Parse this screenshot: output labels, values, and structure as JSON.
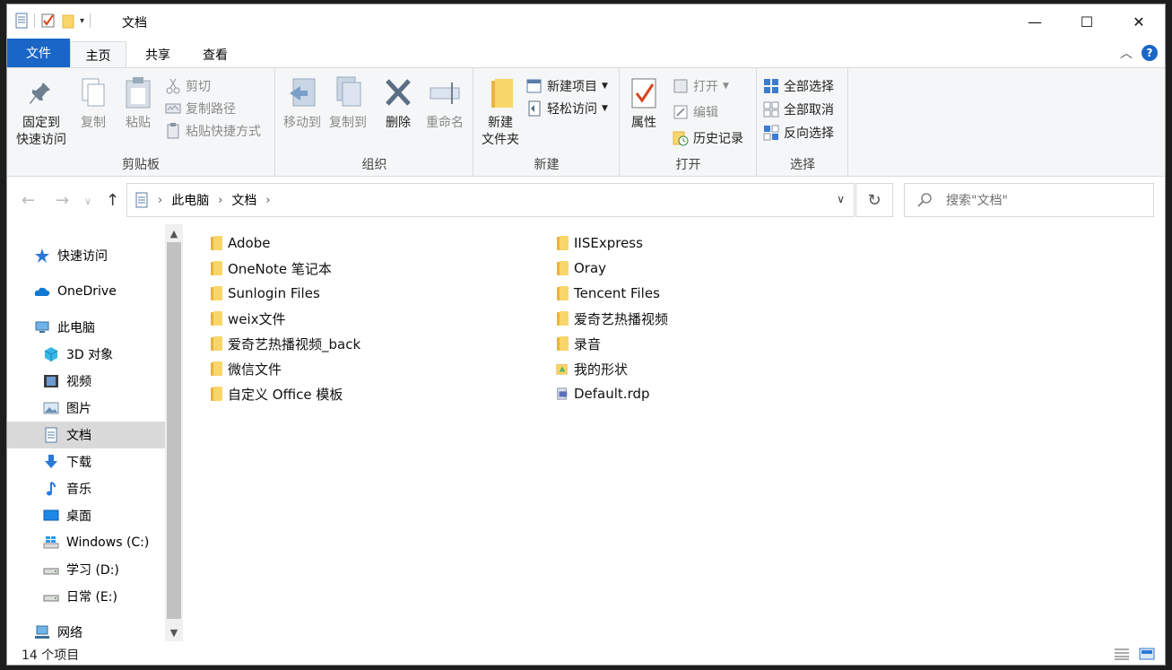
{
  "window": {
    "title": "文档",
    "controls": {
      "minimize": "—",
      "maximize": "☐",
      "close": "✕"
    }
  },
  "tabs": {
    "file": "文件",
    "home": "主页",
    "share": "共享",
    "view": "查看",
    "help": "?",
    "collapse": "︿"
  },
  "ribbon": {
    "clipboard": {
      "label": "剪贴板",
      "pin_line1": "固定到",
      "pin_line2": "快速访问",
      "copy": "复制",
      "paste": "粘贴",
      "cut": "剪切",
      "copy_path": "复制路径",
      "paste_shortcut": "粘贴快捷方式"
    },
    "organize": {
      "label": "组织",
      "move_to": "移动到",
      "copy_to": "复制到",
      "delete": "删除",
      "rename": "重命名"
    },
    "new": {
      "label": "新建",
      "new_folder_line1": "新建",
      "new_folder_line2": "文件夹",
      "new_item": "新建项目",
      "easy_access": "轻松访问"
    },
    "open": {
      "label": "打开",
      "properties": "属性",
      "open": "打开",
      "edit": "编辑",
      "history": "历史记录"
    },
    "select": {
      "label": "选择",
      "select_all": "全部选择",
      "select_none": "全部取消",
      "invert": "反向选择"
    }
  },
  "address": {
    "crumbs": [
      "此电脑",
      "文档"
    ],
    "search_placeholder": "搜索\"文档\""
  },
  "navpane": {
    "items": [
      {
        "label": "快速访问",
        "icon": "star-icon"
      },
      {
        "label": "OneDrive",
        "icon": "cloud-icon"
      },
      {
        "label": "此电脑",
        "icon": "computer-icon"
      },
      {
        "label": "3D 对象",
        "icon": "cube-icon"
      },
      {
        "label": "视频",
        "icon": "film-icon"
      },
      {
        "label": "图片",
        "icon": "picture-icon"
      },
      {
        "label": "文档",
        "icon": "document-icon"
      },
      {
        "label": "下载",
        "icon": "download-icon"
      },
      {
        "label": "音乐",
        "icon": "music-icon"
      },
      {
        "label": "桌面",
        "icon": "desktop-icon"
      },
      {
        "label": "Windows (C:)",
        "icon": "windows-drive-icon"
      },
      {
        "label": "学习 (D:)",
        "icon": "drive-icon"
      },
      {
        "label": "日常 (E:)",
        "icon": "drive-icon"
      },
      {
        "label": "网络",
        "icon": "network-icon"
      }
    ]
  },
  "files": {
    "col1": [
      "Adobe",
      "OneNote 笔记本",
      "Sunlogin Files",
      "weix文件",
      "爱奇艺热播视频_back",
      "微信文件",
      "自定义 Office 模板"
    ],
    "col2": [
      "IISExpress",
      "Oray",
      "Tencent Files",
      "爱奇艺热播视频",
      "录音",
      "我的形状",
      "Default.rdp"
    ]
  },
  "status": {
    "count": "14 个项目"
  },
  "colors": {
    "accent": "#1a66c6",
    "folder": "#f8d66a",
    "selected": "#d9d9d9"
  }
}
